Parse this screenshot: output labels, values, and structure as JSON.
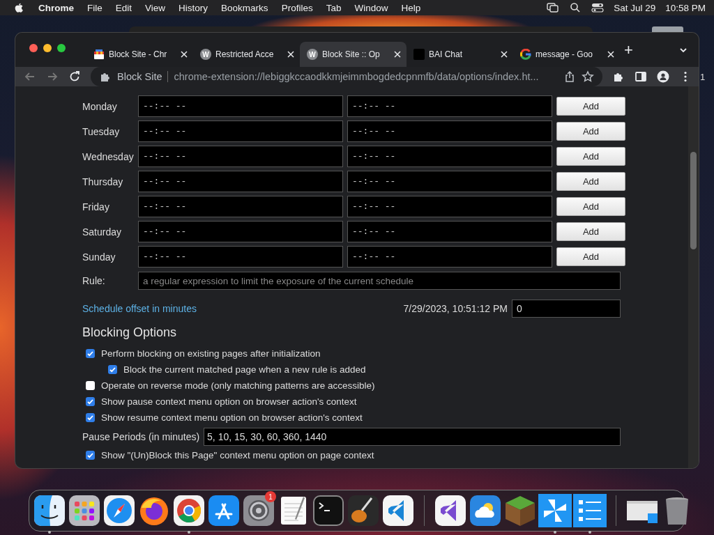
{
  "menu_bar": {
    "app": "Chrome",
    "items": [
      "File",
      "Edit",
      "View",
      "History",
      "Bookmarks",
      "Profiles",
      "Tab",
      "Window",
      "Help"
    ],
    "date": "Sat Jul 29",
    "time": "10:58 PM"
  },
  "desktop": {
    "edge_text": "1"
  },
  "browser": {
    "tabs": [
      {
        "title": "Block Site - Chr",
        "kind": "store",
        "selected": false
      },
      {
        "title": "Restricted Acce",
        "kind": "letter",
        "favicon_letter": "W",
        "selected": false
      },
      {
        "title": "Block Site :: Op",
        "kind": "letter",
        "favicon_letter": "W",
        "selected": true
      },
      {
        "title": "BAI Chat",
        "kind": "dark",
        "selected": false
      },
      {
        "title": "message - Goo",
        "kind": "google",
        "selected": false
      }
    ],
    "new_tab": "+",
    "address": {
      "chip": "Block Site",
      "url": "chrome-extension://lebiggkccaodkkmjeimmbogdedcpnmfb/data/options/index.ht..."
    }
  },
  "schedule": {
    "days": [
      {
        "label": "Monday",
        "start": "--:-- --",
        "end": "--:-- --",
        "button": "Add"
      },
      {
        "label": "Tuesday",
        "start": "--:-- --",
        "end": "--:-- --",
        "button": "Add"
      },
      {
        "label": "Wednesday",
        "start": "--:-- --",
        "end": "--:-- --",
        "button": "Add"
      },
      {
        "label": "Thursday",
        "start": "--:-- --",
        "end": "--:-- --",
        "button": "Add"
      },
      {
        "label": "Friday",
        "start": "--:-- --",
        "end": "--:-- --",
        "button": "Add"
      },
      {
        "label": "Saturday",
        "start": "--:-- --",
        "end": "--:-- --",
        "button": "Add"
      },
      {
        "label": "Sunday",
        "start": "--:-- --",
        "end": "--:-- --",
        "button": "Add"
      }
    ],
    "rule": {
      "label": "Rule:",
      "placeholder": "a regular expression to limit the exposure of the current schedule"
    },
    "offset": {
      "link": "Schedule offset in minutes",
      "timestamp": "7/29/2023, 10:51:12 PM",
      "value": "0"
    }
  },
  "blocking_options": {
    "heading": "Blocking Options",
    "items": [
      {
        "kind": "checkbox",
        "label": "Perform blocking on existing pages after initialization",
        "checked": true,
        "children": [
          {
            "kind": "checkbox",
            "label": "Block the current matched page when a new rule is added",
            "checked": true
          }
        ]
      },
      {
        "kind": "checkbox",
        "label": "Operate on reverse mode (only matching patterns are accessible)",
        "checked": false
      },
      {
        "kind": "checkbox",
        "label": "Show pause context menu option on browser action's context",
        "checked": true
      },
      {
        "kind": "checkbox",
        "label": "Show resume context menu option on browser action's context",
        "checked": true
      },
      {
        "kind": "field",
        "label": "Pause Periods (in minutes)",
        "value": "5, 10, 15, 30, 60, 360, 1440"
      },
      {
        "kind": "checkbox",
        "label": "Show \"(Un)Block this Page\" context menu option on page context",
        "checked": true
      }
    ]
  },
  "dock": {
    "items": [
      {
        "kind": "finder",
        "running": true
      },
      {
        "kind": "launchpad",
        "running": false
      },
      {
        "kind": "safari",
        "running": false
      },
      {
        "kind": "firefox",
        "running": false
      },
      {
        "kind": "chrome",
        "running": true
      },
      {
        "kind": "appstore",
        "running": false
      },
      {
        "kind": "settings",
        "running": false,
        "badge": "1"
      },
      {
        "kind": "textedit",
        "running": false
      },
      {
        "kind": "terminal",
        "running": false
      },
      {
        "kind": "guitar",
        "running": false
      },
      {
        "kind": "vscode",
        "running": false
      },
      {
        "kind": "separator"
      },
      {
        "kind": "vstudio",
        "running": false
      },
      {
        "kind": "weather",
        "running": false
      },
      {
        "kind": "grassblock",
        "running": false
      },
      {
        "kind": "pinwheel",
        "running": true
      },
      {
        "kind": "checklist",
        "running": true
      },
      {
        "kind": "separator"
      },
      {
        "kind": "window",
        "running": false
      },
      {
        "kind": "trash",
        "running": false
      }
    ]
  }
}
